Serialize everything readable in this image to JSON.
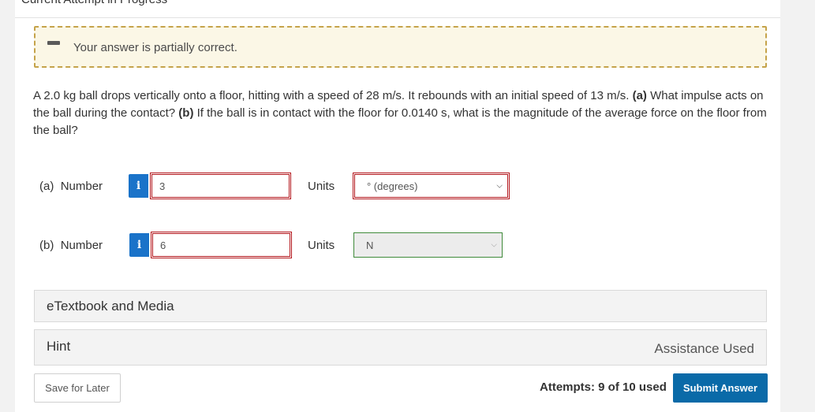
{
  "header": {
    "title": "Current Attempt in Progress"
  },
  "feedback": {
    "icon": "minus-icon",
    "message": "Your answer is partially correct.",
    "border_color": "#c5a34a",
    "bg_color": "#fbf7e6"
  },
  "question": {
    "p1": "A 2.0 kg ball drops vertically onto a floor, hitting with a speed of 28 m/s. It rebounds with an initial speed of 13 m/s. ",
    "a_tag": "(a)",
    "p2": " What impulse acts on the ball during the contact? ",
    "b_tag": "(b)",
    "p3": " If the ball is in contact with the floor for 0.0140 s, what is the magnitude of the average force on the floor from the ball?"
  },
  "parts": [
    {
      "tag": "(a)",
      "label": "Number",
      "info": "i",
      "value": "3",
      "units_label": "Units",
      "units_value": "° (degrees)",
      "status": "incorrect"
    },
    {
      "tag": "(b)",
      "label": "Number",
      "info": "i",
      "value": "6",
      "units_label": "Units",
      "units_value": "N",
      "status": "units-correct"
    }
  ],
  "etextbook": {
    "title": "eTextbook and Media"
  },
  "hint": {
    "title": "Hint",
    "assistance": "Assistance Used"
  },
  "footer": {
    "save_label": "Save for Later",
    "attempts": "Attempts: 9 of 10 used",
    "submit_label": "Submit Answer"
  },
  "colors": {
    "accent": "#0a6aa8",
    "info": "#1a73c9",
    "error": "#b3151b",
    "success": "#3f8a3a"
  }
}
